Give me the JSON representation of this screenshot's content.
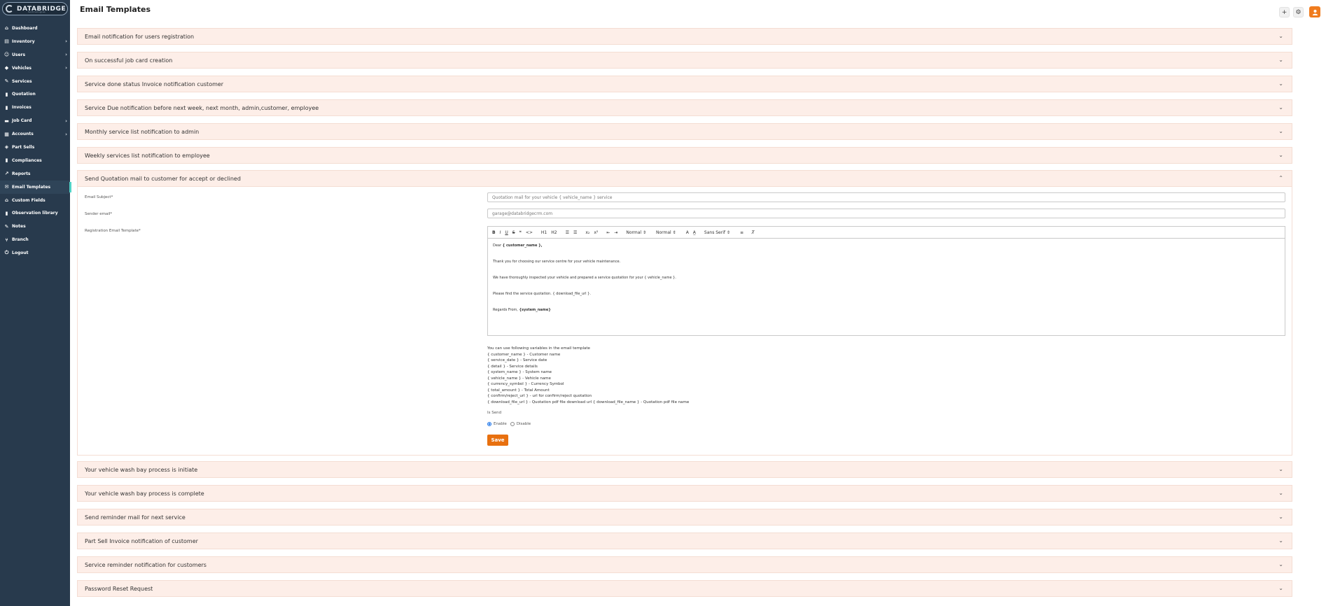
{
  "brand": {
    "name": "DATABRIDGE",
    "tagline": "technologies"
  },
  "sidebar": {
    "items": [
      {
        "label": "Dashboard",
        "icon": "home-icon",
        "chevron": false
      },
      {
        "label": "Inventory",
        "icon": "inventory-icon",
        "chevron": true
      },
      {
        "label": "Users",
        "icon": "user-icon",
        "chevron": true
      },
      {
        "label": "Vehicles",
        "icon": "car-icon",
        "chevron": true
      },
      {
        "label": "Services",
        "icon": "wrench-icon",
        "chevron": false
      },
      {
        "label": "Quotation",
        "icon": "document-icon",
        "chevron": false
      },
      {
        "label": "Invoices",
        "icon": "invoice-icon",
        "chevron": false
      },
      {
        "label": "Job Card",
        "icon": "jobcard-icon",
        "chevron": true
      },
      {
        "label": "Accounts",
        "icon": "accounts-icon",
        "chevron": true
      },
      {
        "label": "Part Sells",
        "icon": "tag-icon",
        "chevron": false
      },
      {
        "label": "Compliances",
        "icon": "compliance-icon",
        "chevron": false
      },
      {
        "label": "Reports",
        "icon": "chart-icon",
        "chevron": false
      },
      {
        "label": "Email Templates",
        "icon": "email-icon",
        "chevron": false,
        "active": true
      },
      {
        "label": "Custom Fields",
        "icon": "fields-icon",
        "chevron": false
      },
      {
        "label": "Observation library",
        "icon": "library-icon",
        "chevron": false
      },
      {
        "label": "Notes",
        "icon": "note-icon",
        "chevron": false
      },
      {
        "label": "Branch",
        "icon": "branch-icon",
        "chevron": false
      },
      {
        "label": "Logout",
        "icon": "power-icon",
        "chevron": false
      }
    ]
  },
  "header": {
    "title": "Email Templates",
    "add_icon": "+",
    "settings_icon": "⚙",
    "avatar_icon": "user-avatar-icon"
  },
  "accordion_top": [
    "Email notification for users registration",
    "On successful job card creation",
    "Service done status Invoice notification customer",
    "Service Due notification before next week, next month, admin,customer, employee",
    "Monthly service list notification to admin",
    "Weekly services list notification to employee"
  ],
  "open_section": {
    "title": "Send Quotation mail to customer for accept or declined",
    "subject_label": "Email Subject*",
    "subject_value": "Quotation mail for your vehicle { vehicle_name } service",
    "sender_label": "Sender email*",
    "sender_value": "garage@databridgecrm.com",
    "template_label": "Registration Email Template*",
    "toolbar": {
      "bold": "B",
      "italic": "I",
      "underline": "U",
      "strike": "S",
      "quote": "❝",
      "code": "<>",
      "h1": "H1",
      "h2": "H2",
      "ol": "☰",
      "ul": "☰",
      "sub": "x₂",
      "sup": "x²",
      "indent_out": "⇤",
      "indent_in": "⇥",
      "size1": "Normal",
      "size2": "Normal",
      "color": "A",
      "bg": "A̲",
      "font": "Sans Serif",
      "align": "≡",
      "clear": "T̸"
    },
    "body": {
      "greet": "Dear ",
      "greet_var": "{ customer_name },",
      "line1": "Thank you for choosing our service centre for your vehicle maintenance.",
      "line2": "We have thoroughly inspected your vehicle and prepared a service quotation for your { vehicle_name }.",
      "line3": "Please find the service quotation. { download_file_url }.",
      "regards": "Regards From, ",
      "regards_var": "{system_name}"
    },
    "vars_intro": "You can use following variables in the email template",
    "vars": [
      "{ customer_name } - Customer name",
      "{ service_date } - Service date",
      "{ detail } - Service details",
      "{ system_name } - System name",
      "{ vehicle_name } - Vehicle name",
      "{ currency_symbol } - Currency Symbol",
      "{ total_amount } - Total Amount",
      "{ confirm/reject_url } - url for confirm/reject quotation",
      "{ download_file_url } - Quotation pdf file download url { download_file_name } - Quotation pdf file name"
    ],
    "is_send_label": "Is Send",
    "enable_label": "Enable",
    "disable_label": "Disable",
    "save_label": "Save"
  },
  "accordion_bottom": [
    "Your vehicle wash bay process is initiate",
    "Your vehicle wash bay process is complete",
    "Send reminder mail for next service",
    "Part Sell Invoice notification of customer",
    "Service reminder notification for customers",
    "Password Reset Request"
  ]
}
